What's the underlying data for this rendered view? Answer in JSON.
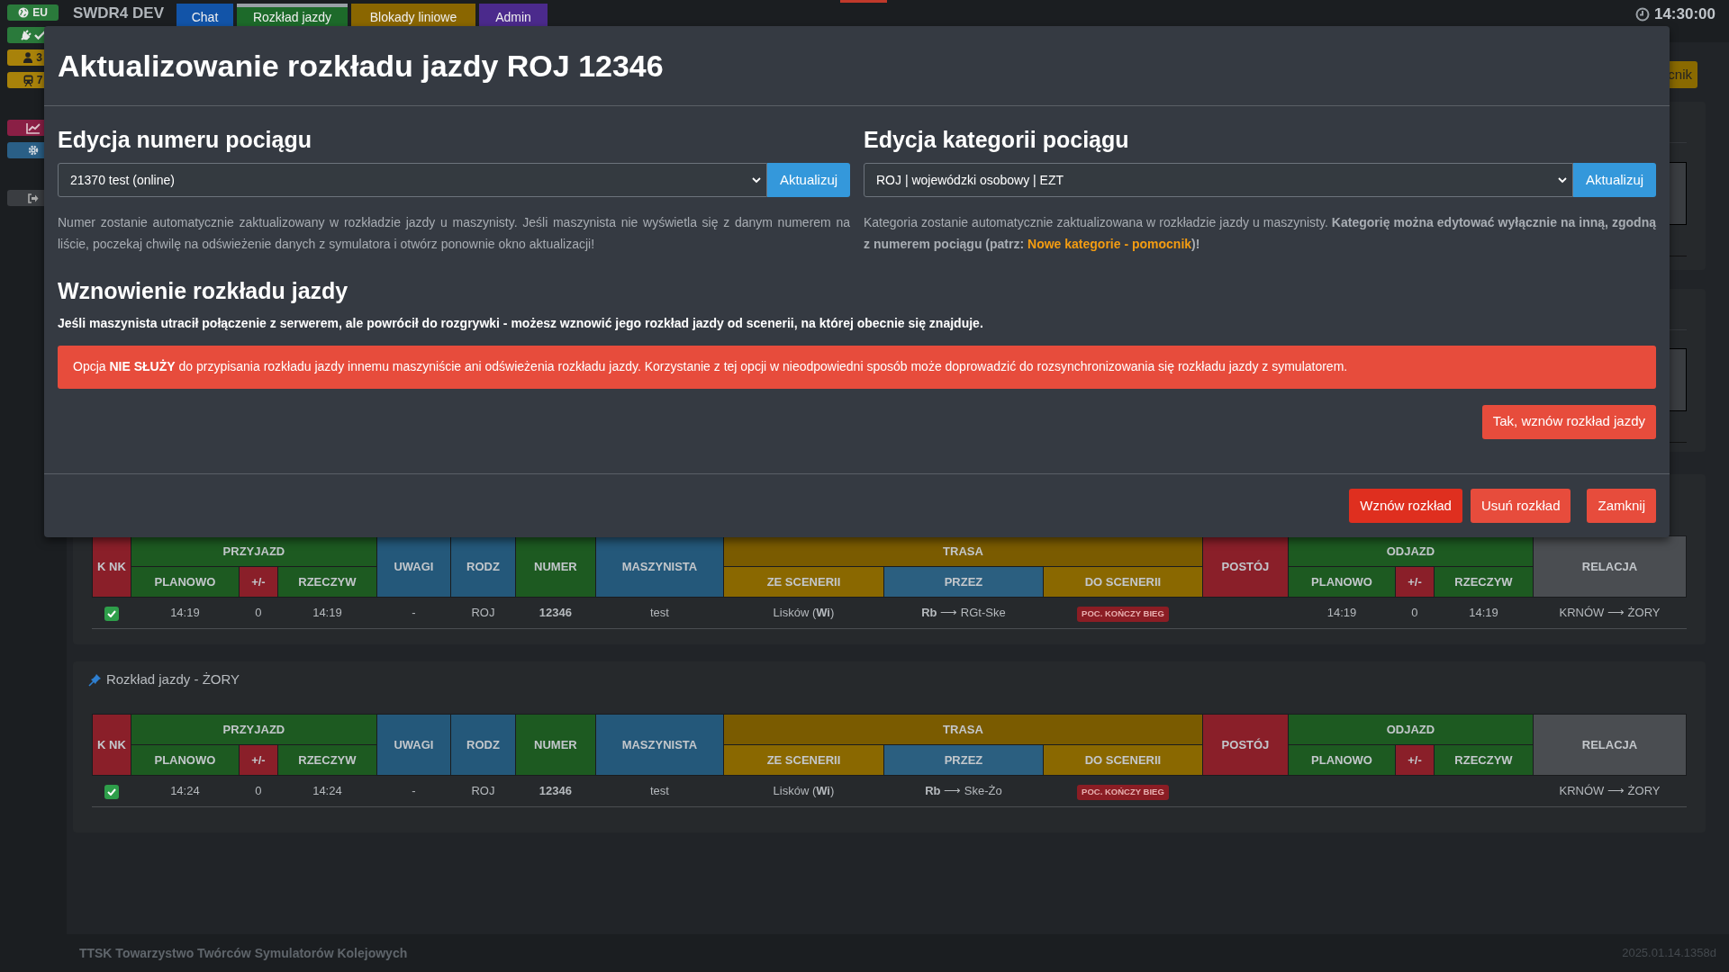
{
  "sidebar": {
    "badges": [
      {
        "kind": "region",
        "label": "EU",
        "color": "#2a7a3b"
      },
      {
        "kind": "connection",
        "color": "#2a7a3b"
      },
      {
        "kind": "users",
        "label": "3",
        "color": "#a8820a"
      },
      {
        "kind": "trains",
        "label": "7",
        "color": "#a8820a"
      },
      {
        "kind": "stats",
        "color": "#8a1f45"
      },
      {
        "kind": "settings",
        "color": "#2a5f86"
      },
      {
        "kind": "logout",
        "color": "#3a3d41"
      }
    ]
  },
  "header": {
    "brand": "SWDR4 DEV",
    "tabs": [
      {
        "label": "Chat",
        "color": "#1254a8",
        "selected": false
      },
      {
        "label": "Rozkład jazdy",
        "color": "#1d6a2a",
        "selected": true
      },
      {
        "label": "Blokady liniowe",
        "color": "#8a6600",
        "selected": false
      },
      {
        "label": "Admin",
        "color": "#4b2a8c",
        "selected": false
      }
    ],
    "clock": "14:30:00"
  },
  "page": {
    "helper_button": "cnik",
    "timetables": [
      {
        "columns": [
          {
            "label": "K NK",
            "color": "#8a1f29"
          },
          {
            "label": "PRZYJAZD",
            "color": "#1d5a21",
            "sub": [
              {
                "label": "PLANOWO",
                "color": "#1d5a21"
              },
              {
                "label": "+/-",
                "color": "#8a1f29"
              },
              {
                "label": "RZECZYW",
                "color": "#1d5a21"
              }
            ]
          },
          {
            "label": "UWAGI",
            "color": "#24587a"
          },
          {
            "label": "RODZ",
            "color": "#24587a"
          },
          {
            "label": "NUMER",
            "color": "#1d5a21"
          },
          {
            "label": "MASZYNISTA",
            "color": "#24587a"
          },
          {
            "label": "TRASA",
            "color": "#7a5b00",
            "sub": [
              {
                "label": "ZE SCENERII",
                "color": "#8a6800"
              },
              {
                "label": "PRZEZ",
                "color": "#2b5f80"
              },
              {
                "label": "DO SCENERII",
                "color": "#8a6800"
              }
            ]
          },
          {
            "label": "POSTÓJ",
            "color": "#8a1f29"
          },
          {
            "label": "ODJAZD",
            "color": "#1d5a21",
            "sub": [
              {
                "label": "PLANOWO",
                "color": "#1d5a21"
              },
              {
                "label": "+/-",
                "color": "#8a1f29"
              },
              {
                "label": "RZECZYW",
                "color": "#1d5a21"
              }
            ]
          },
          {
            "label": "RELACJA",
            "color": "#4a4d51"
          }
        ],
        "rows": [
          {
            "checked": true,
            "arrival_planned": "14:19",
            "arrival_delay": "0",
            "arrival_actual": "14:19",
            "notes": "-",
            "category": "ROJ",
            "number": "12346",
            "driver": "test",
            "from_scenery": "Lisków (**Wi**)",
            "via": "**Rb** ⟶ RGt-Ske",
            "to_scenery_badge": "POC. KOŃCZY BIEG",
            "departure_planned": "14:19",
            "departure_delay": "0",
            "departure_actual": "14:19",
            "route": "KRNÓW ⟶ ŻORY"
          }
        ]
      },
      {
        "title": "Rozkład jazdy - ŻORY",
        "columns": [
          {
            "label": "K NK",
            "color": "#8a1f29"
          },
          {
            "label": "PRZYJAZD",
            "color": "#1d5a21",
            "sub": [
              {
                "label": "PLANOWO",
                "color": "#1d5a21"
              },
              {
                "label": "+/-",
                "color": "#8a1f29"
              },
              {
                "label": "RZECZYW",
                "color": "#1d5a21"
              }
            ]
          },
          {
            "label": "UWAGI",
            "color": "#24587a"
          },
          {
            "label": "RODZ",
            "color": "#24587a"
          },
          {
            "label": "NUMER",
            "color": "#1d5a21"
          },
          {
            "label": "MASZYNISTA",
            "color": "#24587a"
          },
          {
            "label": "TRASA",
            "color": "#7a5b00",
            "sub": [
              {
                "label": "ZE SCENERII",
                "color": "#8a6800"
              },
              {
                "label": "PRZEZ",
                "color": "#2b5f80"
              },
              {
                "label": "DO SCENERII",
                "color": "#8a6800"
              }
            ]
          },
          {
            "label": "POSTÓJ",
            "color": "#8a1f29"
          },
          {
            "label": "ODJAZD",
            "color": "#1d5a21",
            "sub": [
              {
                "label": "PLANOWO",
                "color": "#1d5a21"
              },
              {
                "label": "+/-",
                "color": "#8a1f29"
              },
              {
                "label": "RZECZYW",
                "color": "#1d5a21"
              }
            ]
          },
          {
            "label": "RELACJA",
            "color": "#4a4d51"
          }
        ],
        "rows": [
          {
            "checked": true,
            "arrival_planned": "14:24",
            "arrival_delay": "0",
            "arrival_actual": "14:24",
            "notes": "-",
            "category": "ROJ",
            "number": "12346",
            "driver": "test",
            "from_scenery": "Lisków (**Wi**)",
            "via": "**Rb** ⟶ Ske-Żo",
            "to_scenery_badge": "POC. KOŃCZY BIEG",
            "route": "KRNÓW ⟶ ŻORY"
          }
        ]
      }
    ]
  },
  "modal": {
    "title": "Aktualizowanie rozkładu jazdy ROJ 12346",
    "sections": [
      {
        "heading": "Edycja numeru pociągu",
        "select_value": "21370 test (online)",
        "button": "Aktualizuj",
        "description": "Numer zostanie automatycznie zaktualizowany w rozkładzie jazdy u maszynisty. Jeśli maszynista nie wyświetla się z danym numerem na liście, poczekaj chwilę na odświeżenie danych z symulatora i otwórz ponownie okno aktualizacji!"
      },
      {
        "heading": "Edycja kategorii pociągu",
        "select_value": "ROJ | wojewódzki osobowy | EZT",
        "button": "Aktualizuj",
        "description": "Kategoria zostanie automatycznie zaktualizowana w rozkładzie jazdy u maszynisty. **Kategorię można edytować wyłącznie na inną, zgodną z numerem pociągu (patrz:**",
        "link": "Nowe kategorie - pomocnik",
        "description_after": "**)!**"
      }
    ],
    "resume": {
      "heading": "Wznowienie rozkładu jazdy",
      "text": "Jeśli maszynista utracił połączenie z serwerem, ale powrócił do rozgrywki - możesz wznowić jego rozkład jazdy od scenerii, na której obecnie się znajduje.",
      "alert_before": "Opcja",
      "alert_bold": "NIE SŁUŻY",
      "alert_after": "do przypisania rozkładu jazdy innemu maszyniście ani odświeżenia rozkładu jazdy. Korzystanie z tej opcji w nieodpowiedni sposób może doprowadzić do rozsynchronizowania się rozkładu jazdy z symulatorem.",
      "button": "Tak, wznów rozkład jazdy"
    },
    "footer_buttons": [
      {
        "label": "Wznów rozkład",
        "kind": "primary"
      },
      {
        "label": "Usuń rozkład",
        "kind": "secondary"
      },
      {
        "label": "Zamknij",
        "kind": "secondary"
      }
    ]
  },
  "footer": {
    "text": "TTSK Towarzystwo Twórców Symulatorów Kolejowych",
    "version": "2025.01.14.1358d"
  }
}
